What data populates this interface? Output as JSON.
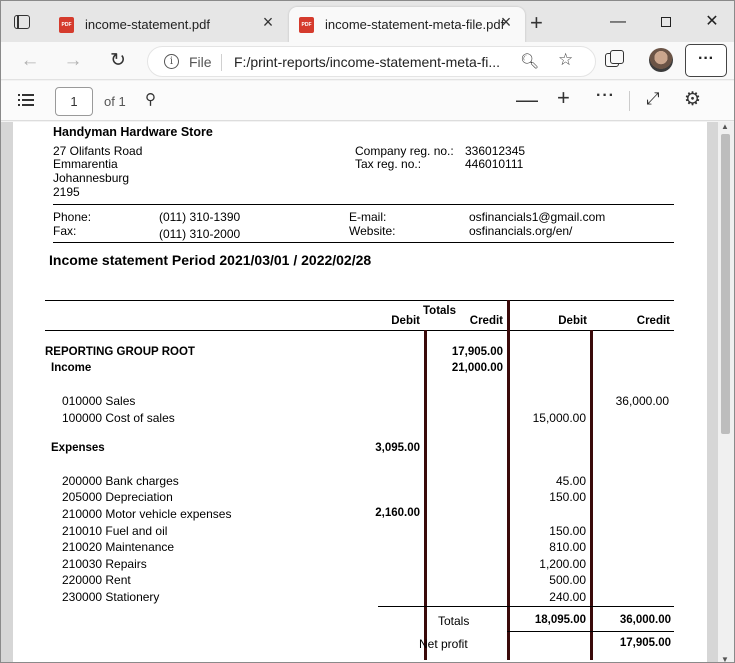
{
  "browser": {
    "tabs": [
      {
        "title": "income-statement.pdf",
        "favicon": "pdf-icon"
      },
      {
        "title": "income-statement-meta-file.pdf",
        "favicon": "pdf-icon"
      }
    ],
    "address": {
      "scheme_label": "File",
      "url": "F:/print-reports/income-statement-meta-fi..."
    }
  },
  "pdf_toolbar": {
    "page_current": "1",
    "page_total": "of 1"
  },
  "document": {
    "company_name": "Handyman Hardware Store",
    "address_lines": [
      "27 Olifants Road",
      "Emmarentia",
      "Johannesburg",
      "2195"
    ],
    "reg_label": "Company reg. no.:",
    "reg_value": "336012345",
    "tax_label": "Tax reg. no.:",
    "tax_value": "446010111",
    "phone_label": "Phone:",
    "phone_value": "(011) 310-1390",
    "fax_label": "Fax:",
    "fax_value": "(011) 310-2000",
    "email_label": "E-mail:",
    "email_value": "osfinancials1@gmail.com",
    "website_label": "Website:",
    "website_value": "osfinancials.org/en/",
    "title": "Income statement Period  2021/03/01 / 2022/02/28",
    "headers": {
      "totals": "Totals",
      "debit1": "Debit",
      "credit1": "Credit",
      "debit2": "Debit",
      "credit2": "Credit"
    },
    "root_label": "REPORTING GROUP ROOT",
    "root_credit": "17,905.00",
    "income_label": "Income",
    "income_credit": "21,000.00",
    "income_rows": [
      {
        "account": "010000 Sales",
        "debit": "",
        "credit": "36,000.00"
      },
      {
        "account": "100000 Cost of sales",
        "debit": "15,000.00",
        "credit": ""
      }
    ],
    "expenses_label": "Expenses",
    "expenses_debit": "3,095.00",
    "expense_rows": [
      {
        "account": "200000 Bank charges",
        "debit1": "",
        "debit": "45.00"
      },
      {
        "account": "205000 Depreciation",
        "debit1": "",
        "debit": "150.00"
      },
      {
        "account": "210000 Motor vehicle expenses",
        "debit1": "2,160.00",
        "debit": ""
      },
      {
        "account": "210010 Fuel and oil",
        "debit1": "",
        "debit": "150.00"
      },
      {
        "account": "210020 Maintenance",
        "debit1": "",
        "debit": "810.00"
      },
      {
        "account": "210030 Repairs",
        "debit1": "",
        "debit": "1,200.00"
      },
      {
        "account": "220000 Rent",
        "debit1": "",
        "debit": "500.00"
      },
      {
        "account": "230000 Stationery",
        "debit1": "",
        "debit": "240.00"
      }
    ],
    "totals_label": "Totals",
    "totals_debit": "18,095.00",
    "totals_credit": "36,000.00",
    "net_profit_label": "Net profit",
    "net_profit_value": "17,905.00"
  }
}
